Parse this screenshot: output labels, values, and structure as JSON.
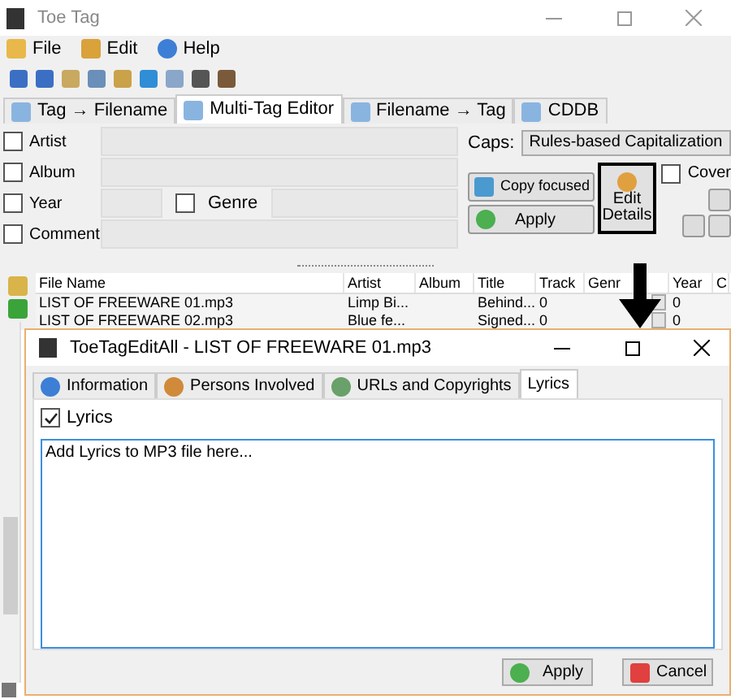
{
  "window": {
    "title": "Toe Tag"
  },
  "menu": [
    "File",
    "Edit",
    "Help"
  ],
  "tabs": [
    {
      "label": "Tag → Filename",
      "selected": false
    },
    {
      "label": "Multi-Tag Editor",
      "selected": true
    },
    {
      "label": "Filename → Tag",
      "selected": false
    },
    {
      "label": "CDDB",
      "selected": false
    }
  ],
  "artist": {
    "label": "Artist",
    "checked": false
  },
  "album": {
    "label": "Album",
    "checked": false
  },
  "year": {
    "label": "Year",
    "checked": false
  },
  "genre": {
    "label": "Genre",
    "checked": false
  },
  "comment": {
    "label": "Comment",
    "checked": false
  },
  "caps": {
    "label": "Caps:",
    "value": "Rules-based Capitalization"
  },
  "cover": {
    "label": "Cover",
    "checked": false
  },
  "copy_focused": "Copy focused",
  "apply": "Apply",
  "edit_details": "Edit Details",
  "table": {
    "columns": [
      "File Name",
      "Artist",
      "Album",
      "Title",
      "Track",
      "Genr",
      "Year",
      "C"
    ],
    "rows": [
      {
        "file_name": "LIST OF FREEWARE 01.mp3",
        "artist": "Limp Bi...",
        "title": "Behind...",
        "track": "0",
        "year": "0"
      },
      {
        "file_name": "LIST OF FREEWARE 02.mp3",
        "artist": "Blue fe...",
        "title": "Signed...",
        "track": "0",
        "year": "0"
      }
    ]
  },
  "dialog": {
    "title": "ToeTagEditAll - LIST OF FREEWARE 01.mp3",
    "tabs": [
      {
        "label": "Information",
        "selected": false
      },
      {
        "label": "Persons Involved",
        "selected": false
      },
      {
        "label": "URLs and Copyrights",
        "selected": false
      },
      {
        "label": "Lyrics",
        "selected": true
      }
    ],
    "lyrics_checkbox": {
      "label": "Lyrics",
      "checked": true
    },
    "lyrics": "Add Lyrics to MP3 file here...",
    "buttons": [
      "Apply",
      "Cancel"
    ]
  }
}
